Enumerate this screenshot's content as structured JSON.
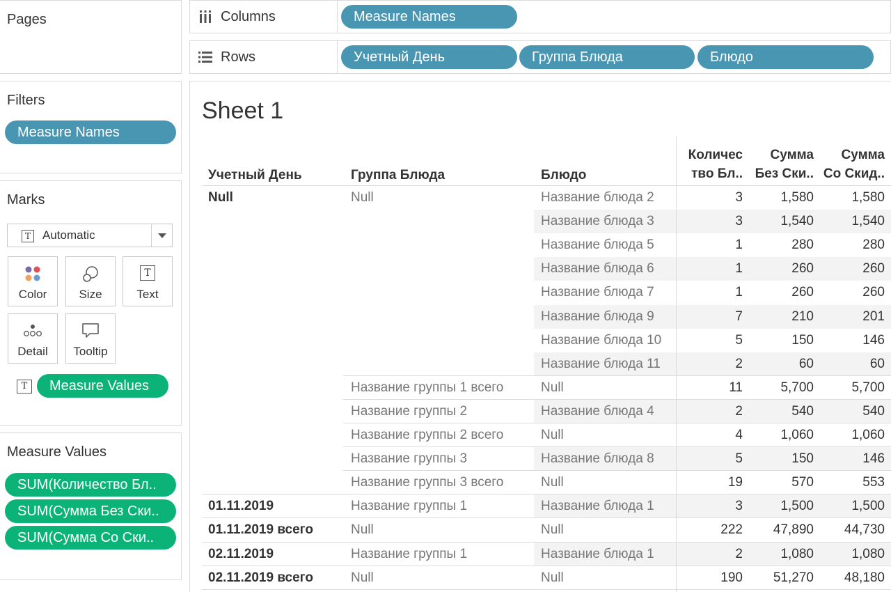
{
  "pages": {
    "title": "Pages"
  },
  "shelves": {
    "columns": {
      "label": "Columns",
      "pills": [
        "Measure Names"
      ]
    },
    "rows": {
      "label": "Rows",
      "pills": [
        "Учетный День",
        "Группа Блюда",
        "Блюдо"
      ]
    }
  },
  "filters": {
    "title": "Filters",
    "pills": [
      "Measure Names"
    ]
  },
  "marks": {
    "title": "Marks",
    "type_value": "Automatic",
    "buttons": [
      {
        "label": "Color",
        "icon": "color-icon"
      },
      {
        "label": "Size",
        "icon": "size-icon"
      },
      {
        "label": "Text",
        "icon": "text-icon"
      },
      {
        "label": "Detail",
        "icon": "detail-icon"
      },
      {
        "label": "Tooltip",
        "icon": "tooltip-icon"
      }
    ],
    "text_pill": "Measure Values"
  },
  "measure_values": {
    "title": "Measure Values",
    "pills": [
      "SUM(Количество Бл..",
      "SUM(Сумма Без Ски..",
      "SUM(Сумма Со Ски.."
    ]
  },
  "view": {
    "sheet_title": "Sheet 1",
    "headers": {
      "day": "Учетный День",
      "group": "Группа Блюда",
      "dish": "Блюдо",
      "qty_line1": "Количес",
      "qty_line2": "тво Бл..",
      "sum_no_disc_line1": "Сумма",
      "sum_no_disc_line2": "Без Ски..",
      "sum_disc_line1": "Сумма",
      "sum_disc_line2": "Со Скид.."
    },
    "rows": [
      {
        "day": "Null",
        "group": "Null",
        "dish": "Название блюда 2",
        "qty": "3",
        "sum1": "1,580",
        "sum2": "1,580"
      },
      {
        "day": "",
        "group": "",
        "dish": "Название блюда 3",
        "qty": "3",
        "sum1": "1,540",
        "sum2": "1,540"
      },
      {
        "day": "",
        "group": "",
        "dish": "Название блюда 5",
        "qty": "1",
        "sum1": "280",
        "sum2": "280"
      },
      {
        "day": "",
        "group": "",
        "dish": "Название блюда 6",
        "qty": "1",
        "sum1": "260",
        "sum2": "260"
      },
      {
        "day": "",
        "group": "",
        "dish": "Название блюда 7",
        "qty": "1",
        "sum1": "260",
        "sum2": "260"
      },
      {
        "day": "",
        "group": "",
        "dish": "Название блюда 9",
        "qty": "7",
        "sum1": "210",
        "sum2": "201"
      },
      {
        "day": "",
        "group": "",
        "dish": "Название блюда 10",
        "qty": "5",
        "sum1": "150",
        "sum2": "146"
      },
      {
        "day": "",
        "group": "",
        "dish": "Название блюда 11",
        "qty": "2",
        "sum1": "60",
        "sum2": "60"
      },
      {
        "day": "",
        "group": "Название группы 1 всего",
        "dish": "Null",
        "qty": "11",
        "sum1": "5,700",
        "sum2": "5,700"
      },
      {
        "day": "",
        "group": "Название группы 2",
        "dish": "Название блюда 4",
        "qty": "2",
        "sum1": "540",
        "sum2": "540"
      },
      {
        "day": "",
        "group": "Название группы 2 всего",
        "dish": "Null",
        "qty": "4",
        "sum1": "1,060",
        "sum2": "1,060"
      },
      {
        "day": "",
        "group": "Название группы 3",
        "dish": "Название блюда 8",
        "qty": "5",
        "sum1": "150",
        "sum2": "146"
      },
      {
        "day": "",
        "group": "Название группы 3 всего",
        "dish": "Null",
        "qty": "19",
        "sum1": "570",
        "sum2": "553"
      },
      {
        "day": "01.11.2019",
        "group": "Название группы 1",
        "dish": "Название блюда 1",
        "qty": "3",
        "sum1": "1,500",
        "sum2": "1,500"
      },
      {
        "day": "01.11.2019 всего",
        "group": "Null",
        "dish": "Null",
        "qty": "222",
        "sum1": "47,890",
        "sum2": "44,730"
      },
      {
        "day": "02.11.2019",
        "group": "Название группы 1",
        "dish": "Название блюда 1",
        "qty": "2",
        "sum1": "1,080",
        "sum2": "1,080"
      },
      {
        "day": "02.11.2019 всего",
        "group": "Null",
        "dish": "Null",
        "qty": "190",
        "sum1": "51,270",
        "sum2": "48,180"
      }
    ]
  }
}
